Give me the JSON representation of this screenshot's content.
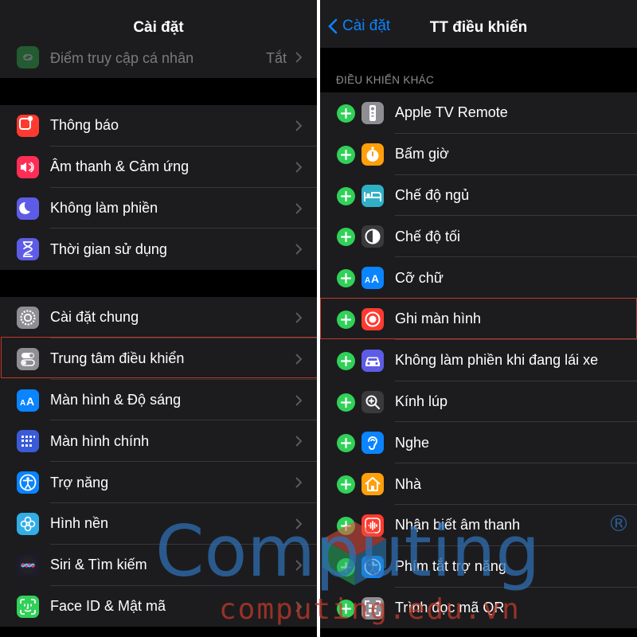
{
  "left": {
    "title": "Cài đặt",
    "top_row": {
      "label": "Điểm truy cập cá nhân",
      "value": "Tắt"
    },
    "group1": [
      {
        "label": "Thông báo",
        "icon": "notifications-icon"
      },
      {
        "label": "Âm thanh & Cảm ứng",
        "icon": "sound-icon"
      },
      {
        "label": "Không làm phiền",
        "icon": "moon-icon"
      },
      {
        "label": "Thời gian sử dụng",
        "icon": "hourglass-icon"
      }
    ],
    "group2": [
      {
        "label": "Cài đặt chung",
        "icon": "gear-icon"
      },
      {
        "label": "Trung tâm điều khiển",
        "icon": "toggles-icon"
      },
      {
        "label": "Màn hình & Độ sáng",
        "icon": "text-size-icon"
      },
      {
        "label": "Màn hình chính",
        "icon": "home-grid-icon"
      },
      {
        "label": "Trợ năng",
        "icon": "accessibility-icon"
      },
      {
        "label": "Hình nền",
        "icon": "flower-icon"
      },
      {
        "label": "Siri & Tìm kiếm",
        "icon": "siri-icon"
      },
      {
        "label": "Face ID & Mật mã",
        "icon": "face-id-icon"
      }
    ]
  },
  "right": {
    "back_label": "Cài đặt",
    "title": "TT điều khiển",
    "section_header": "ĐIỀU KHIỂN KHÁC",
    "items": [
      {
        "label": "Apple TV Remote",
        "icon": "tv-remote-icon"
      },
      {
        "label": "Bấm giờ",
        "icon": "stopwatch-icon"
      },
      {
        "label": "Chế độ ngủ",
        "icon": "bed-icon"
      },
      {
        "label": "Chế độ tối",
        "icon": "dark-mode-icon"
      },
      {
        "label": "Cỡ chữ",
        "icon": "text-size-icon"
      },
      {
        "label": "Ghi màn hình",
        "icon": "screen-record-icon"
      },
      {
        "label": "Không làm phiền khi đang lái xe",
        "icon": "car-icon"
      },
      {
        "label": "Kính lúp",
        "icon": "magnifier-icon"
      },
      {
        "label": "Nghe",
        "icon": "ear-icon"
      },
      {
        "label": "Nhà",
        "icon": "home-icon"
      },
      {
        "label": "Nhận biết âm thanh",
        "icon": "sound-recognition-icon"
      },
      {
        "label": "Phím tắt trợ năng",
        "icon": "accessibility-icon"
      },
      {
        "label": "Trình đọc mã QR",
        "icon": "qr-code-icon"
      }
    ]
  },
  "watermark": {
    "text": "Computing",
    "url": "computing.edu.vn",
    "mark": "®"
  },
  "colors": {
    "accent": "#0a84ff",
    "add": "#30d158",
    "highlight": "#c0392b"
  }
}
